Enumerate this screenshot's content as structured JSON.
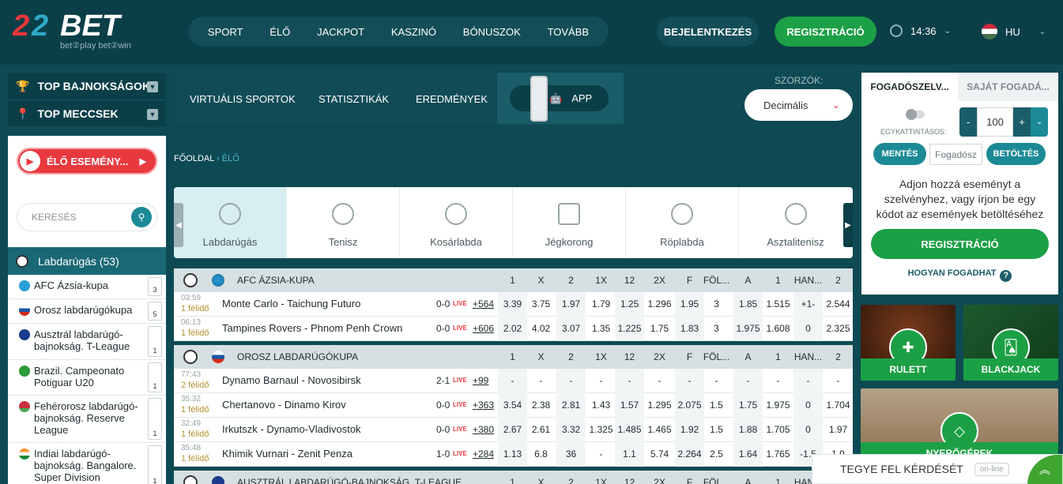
{
  "header": {
    "logo_main": "22BET",
    "logo_sub": "bet②play  bet②win",
    "nav": [
      "SPORT",
      "ÉLŐ",
      "JACKPOT",
      "KASZINÓ",
      "BÓNUSZOK",
      "TOVÁBB"
    ],
    "login": "BEJELENTKEZÉS",
    "register": "REGISZTRÁCIÓ",
    "time": "14:36",
    "lang": "HU"
  },
  "sidebar": {
    "top_leagues": "TOP BAJNOKSÁGOK",
    "top_matches": "TOP MECCSEK",
    "live": "ÉLŐ ESEMÉNY...",
    "search_placeholder": "KERESÉS",
    "sport": "Labdarúgás (53)",
    "leagues": [
      {
        "name": "AFC Ázsia-kupa",
        "count": "3"
      },
      {
        "name": "Orosz labdarúgókupa",
        "count": "5"
      },
      {
        "name": "Ausztrál labdarúgó-bajnokság. T-League",
        "count": "1"
      },
      {
        "name": "Brazil. Campeonato Potiguar U20",
        "count": "1"
      },
      {
        "name": "Fehérorosz labdarúgó-bajnokság. Reserve League",
        "count": "1"
      },
      {
        "name": "Indiai labdarúgó-bajnokság. Bangalore. Super Division",
        "count": "1"
      }
    ]
  },
  "tabs": {
    "virtual": "VIRTUÁLIS SPORTOK",
    "stats": "STATISZTIKÁK",
    "results": "EREDMÉNYEK",
    "app": "APP",
    "odds_label": "SZORZÓK:",
    "odds_value": "Decimális"
  },
  "breadcrumb": {
    "home": "FŐOLDAL",
    "current": "ÉLŐ"
  },
  "sports": [
    "Labdarúgás",
    "Tenisz",
    "Kosárlabda",
    "Jégkorong",
    "Röplabda",
    "Asztalitenisz"
  ],
  "columns": [
    "1",
    "X",
    "2",
    "1X",
    "12",
    "2X",
    "F",
    "FÖL...",
    "A",
    "1",
    "HAN...",
    "2"
  ],
  "leagues": [
    {
      "name": "AFC ÁZSIA-KUPA",
      "rows": [
        {
          "time": "03:59",
          "half": "1 félidő",
          "teams": "Monte Carlo - Taichung Futuro",
          "score": "0-0",
          "live": "LIVE",
          "more": "+564",
          "odds": [
            "3.39",
            "3.75",
            "1.97",
            "1.79",
            "1.25",
            "1.296",
            "1.95",
            "3",
            "1.85",
            "1.515",
            "+1-",
            "2.544"
          ]
        },
        {
          "time": "06:13",
          "half": "1 félidő",
          "teams": "Tampines Rovers - Phnom Penh Crown",
          "score": "0-0",
          "live": "LIVE",
          "more": "+606",
          "odds": [
            "2.02",
            "4.02",
            "3.07",
            "1.35",
            "1.225",
            "1.75",
            "1.83",
            "3",
            "1.975",
            "1.608",
            "0",
            "2.325"
          ]
        }
      ]
    },
    {
      "name": "OROSZ LABDARÚGÓKUPA",
      "rows": [
        {
          "time": "77:43",
          "half": "2 félidő",
          "teams": "Dynamo Barnaul - Novosibirsk",
          "score": "2-1",
          "live": "LIVE",
          "more": "+99",
          "odds": [
            "-",
            "-",
            "-",
            "-",
            "-",
            "-",
            "-",
            "-",
            "-",
            "-",
            "-",
            "-"
          ]
        },
        {
          "time": "35:32",
          "half": "1 félidő",
          "teams": "Chertanovo - Dinamo Kirov",
          "score": "0-0",
          "live": "LIVE",
          "more": "+363",
          "odds": [
            "3.54",
            "2.38",
            "2.81",
            "1.43",
            "1.57",
            "1.295",
            "2.075",
            "1.5",
            "1.75",
            "1.975",
            "0",
            "1.704"
          ]
        },
        {
          "time": "32:49",
          "half": "1 félidő",
          "teams": "Irkutszk - Dynamo-Vladivostok",
          "score": "0-0",
          "live": "LIVE",
          "more": "+380",
          "odds": [
            "2.67",
            "2.61",
            "3.32",
            "1.325",
            "1.485",
            "1.465",
            "1.92",
            "1.5",
            "1.88",
            "1.705",
            "0",
            "1.97"
          ]
        },
        {
          "time": "35:48",
          "half": "1 félidő",
          "teams": "Khimik Vurnari - Zenit Penza",
          "score": "1-0",
          "live": "LIVE",
          "more": "+284",
          "odds": [
            "1.13",
            "6.8",
            "36",
            "-",
            "1.1",
            "5.74",
            "2.264",
            "2.5",
            "1.64",
            "1.765",
            "-1.5",
            "1.9"
          ]
        }
      ]
    },
    {
      "name": "AUSZTRÁL LABDARÚGÓ-BAJNOKSÁG. T-LEAGUE",
      "rows": []
    }
  ],
  "slip": {
    "tab1": "FOGADÓSZELV...",
    "tab2": "SAJÁT FOGADÁ...",
    "one_click": "EGYKATTINTÁSOS:",
    "stake": "100",
    "save": "MENTÉS",
    "code_placeholder": "Fogadósz",
    "load": "BETÖLTÉS",
    "message": "Adjon hozzá eseményt a szelvényhez, vagy írjon be egy kódot az események betöltéséhez",
    "register": "REGISZTRÁCIÓ",
    "how": "HOGYAN FOGADHAT"
  },
  "casino": {
    "roulette": "RULETT",
    "blackjack": "BLACKJACK",
    "third": "NYERŐGÉPEK"
  },
  "chat": {
    "label": "TEGYE FEL KÉRDÉSÉT",
    "status": "on-line"
  }
}
